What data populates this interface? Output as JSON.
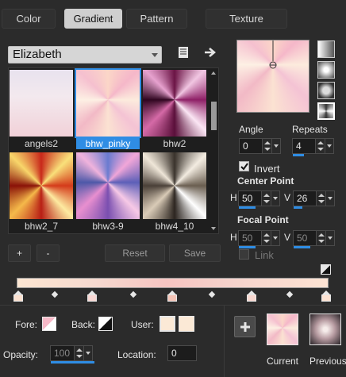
{
  "tabs": [
    {
      "label": "Color",
      "active": false
    },
    {
      "label": "Gradient",
      "active": true
    },
    {
      "label": "Pattern",
      "active": false
    },
    {
      "label": "Texture",
      "active": false
    }
  ],
  "gradient_set": {
    "selected": "Elizabeth"
  },
  "thumbnails": [
    {
      "label": "angels2",
      "selected": false
    },
    {
      "label": "bhw_pinky",
      "selected": true
    },
    {
      "label": "bhw2",
      "selected": false
    },
    {
      "label": "bhw2_7",
      "selected": false
    },
    {
      "label": "bhw3-9",
      "selected": false
    },
    {
      "label": "bhw4_10",
      "selected": false
    }
  ],
  "list_buttons": {
    "add": "+",
    "remove": "-",
    "reset": "Reset",
    "save": "Save"
  },
  "angle": {
    "label": "Angle",
    "value": "0"
  },
  "repeats": {
    "label": "Repeats",
    "value": "4"
  },
  "invert": {
    "label": "Invert",
    "checked": true
  },
  "center_point": {
    "label": "Center Point",
    "h_label": "H",
    "h_value": "50",
    "v_label": "V",
    "v_value": "26"
  },
  "focal_point": {
    "label": "Focal Point",
    "h_label": "H",
    "h_value": "50",
    "v_label": "V",
    "v_value": "50"
  },
  "link": {
    "label": "Link",
    "checked": false
  },
  "bottom": {
    "fore_label": "Fore:",
    "back_label": "Back:",
    "user_label": "User:",
    "opacity_label": "Opacity:",
    "opacity_value": "100",
    "location_label": "Location:",
    "location_value": "0",
    "add_symbol": "+",
    "current_label": "Current",
    "previous_label": "Previous"
  },
  "colors": {
    "accent": "#2f8de4",
    "background": "#2b2b2b",
    "gradient_light": "#f6e0cf",
    "gradient_pink": "#f2c7d6"
  }
}
